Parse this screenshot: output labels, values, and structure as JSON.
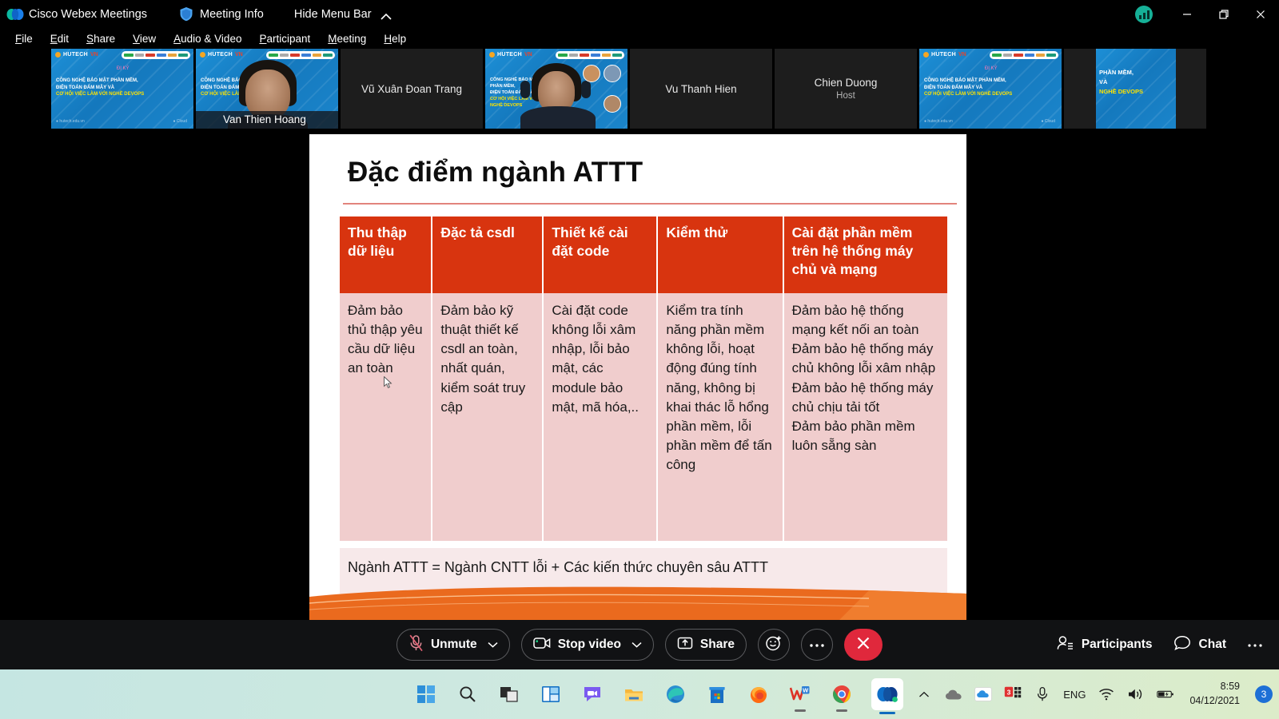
{
  "titlebar": {
    "app_name": "Cisco Webex Meetings",
    "logo_icon": "webex-logo-icon",
    "meeting_info_label": "Meeting Info",
    "meeting_info_icon": "shield-icon",
    "hide_menu_label": "Hide Menu Bar",
    "hide_menu_icon": "chevron-up-icon",
    "network_icon": "network-quality-icon",
    "minimize_icon": "minimize-icon",
    "restore_icon": "restore-icon",
    "close_icon": "close-icon"
  },
  "menubar": {
    "items": [
      {
        "label": "File",
        "accel": "F"
      },
      {
        "label": "Edit",
        "accel": "E"
      },
      {
        "label": "Share",
        "accel": "S"
      },
      {
        "label": "View",
        "accel": "V"
      },
      {
        "label": "Audio & Video",
        "accel": "A"
      },
      {
        "label": "Participant",
        "accel": "P"
      },
      {
        "label": "Meeting",
        "accel": "M"
      },
      {
        "label": "Help",
        "accel": "H"
      }
    ]
  },
  "thumbnails": [
    {
      "name": "",
      "role": "",
      "kind": "slide",
      "active": false,
      "label_pos": "none"
    },
    {
      "name": "Van Thien Hoang",
      "role": "",
      "kind": "person-slide",
      "active": true,
      "label_pos": "bottom"
    },
    {
      "name": "Vũ Xuân Đoan Trang",
      "role": "",
      "kind": "name",
      "active": false,
      "label_pos": "center"
    },
    {
      "name": "",
      "role": "",
      "kind": "person-slide2",
      "active": false,
      "label_pos": "none"
    },
    {
      "name": "Vu Thanh Hien",
      "role": "",
      "kind": "name",
      "active": false,
      "label_pos": "center"
    },
    {
      "name": "Chien Duong",
      "role": "Host",
      "kind": "name",
      "active": false,
      "label_pos": "center"
    },
    {
      "name": "",
      "role": "",
      "kind": "slide",
      "active": false,
      "label_pos": "none"
    },
    {
      "name": "",
      "role": "",
      "kind": "slide-cropped",
      "active": false,
      "label_pos": "none"
    }
  ],
  "mini_slide": {
    "brand": "HUTECH",
    "brand_sub": "Đại học Công nghệ TP.HCM",
    "title_line1": "CÔNG NGHỆ BẢO MẬT PHẦN MỀM,",
    "title_line2": "ĐIỆN TOÁN ĐÁM MÂY VÀ",
    "title_line3": "CƠ HỘI VIỆC LÀM VỚI NGHỀ DEVOPS",
    "cropped_line1": "PHẦN MỀM,",
    "cropped_line2": "VÀ",
    "cropped_line3": "NGHỀ DEVOPS"
  },
  "slide": {
    "title": "Đặc điểm ngành ATTT",
    "table": {
      "headers": [
        "Thu thập dữ liệu",
        "Đặc tả csdl",
        "Thiết kế cài đặt code",
        "Kiểm thử",
        "Cài đặt phần mềm trên hệ thống máy chủ và mạng"
      ],
      "row": [
        "Đảm bảo thủ thập yêu cầu dữ liệu an toàn",
        "Đảm bảo kỹ thuật thiết kế csdl an toàn, nhất quán, kiểm soát truy cập",
        "Cài đặt code không lỗi xâm nhập, lỗi bảo mật, các module bảo mật, mã hóa,..",
        "Kiểm tra tính năng phần mềm không lỗi, hoạt động đúng tính năng, không bị khai thác lỗ hổng phần mềm, lỗi phần mềm để tấn công",
        "Đảm bảo hệ thống mạng kết nối an toàn\nĐảm bảo hệ thống máy chủ không lỗi xâm nhập\nĐảm bảo hệ thống máy chủ chịu tải tốt\nĐảm bảo phần mềm luôn sẵng sàn"
      ]
    },
    "footer_line": "Ngành ATTT = Ngành CNTT lỗi + Các kiến thức chuyên sâu ATTT",
    "header_color": "#d8340f",
    "cell_color": "#f0cdcd",
    "footer_color": "#f7e9ea",
    "accent_color": "#e8641f"
  },
  "controls": {
    "mute": {
      "label": "Unmute",
      "icon": "microphone-muted-icon",
      "caret": "chevron-down-icon"
    },
    "video": {
      "label": "Stop video",
      "icon": "camera-icon",
      "caret": "chevron-down-icon"
    },
    "share": {
      "label": "Share",
      "icon": "share-screen-icon"
    },
    "reactions": {
      "icon": "reactions-smiley-icon"
    },
    "more": {
      "icon": "more-options-icon"
    },
    "end": {
      "icon": "end-meeting-icon"
    },
    "participants": {
      "label": "Participants",
      "icon": "participants-icon"
    },
    "chat": {
      "label": "Chat",
      "icon": "chat-bubble-icon"
    },
    "more_right": {
      "icon": "more-options-icon"
    }
  },
  "taskbar": {
    "icons": [
      {
        "name": "start-icon",
        "open": false
      },
      {
        "name": "search-icon",
        "open": false
      },
      {
        "name": "task-view-icon",
        "open": false
      },
      {
        "name": "widgets-icon",
        "open": false
      },
      {
        "name": "teams-chat-icon",
        "open": false
      },
      {
        "name": "file-explorer-icon",
        "open": false
      },
      {
        "name": "edge-icon",
        "open": false
      },
      {
        "name": "microsoft-store-icon",
        "open": false
      },
      {
        "name": "firefox-icon",
        "open": false
      },
      {
        "name": "wps-office-icon",
        "open": true
      },
      {
        "name": "chrome-icon",
        "open": true
      },
      {
        "name": "webex-icon",
        "open": true
      }
    ],
    "tray": {
      "overflow_icon": "chevron-up-icon",
      "onedrive_gray_icon": "onedrive-gray-icon",
      "onedrive_blue_icon": "onedrive-blue-icon",
      "app_badge_icon": "unikey-icon",
      "app_badge_count": "3",
      "mic_icon": "microphone-icon",
      "language": "ENG",
      "wifi_icon": "wifi-icon",
      "volume_icon": "volume-icon",
      "battery_icon": "battery-charging-icon",
      "time": "8:59",
      "date": "04/12/2021",
      "notification_count": "3"
    }
  }
}
